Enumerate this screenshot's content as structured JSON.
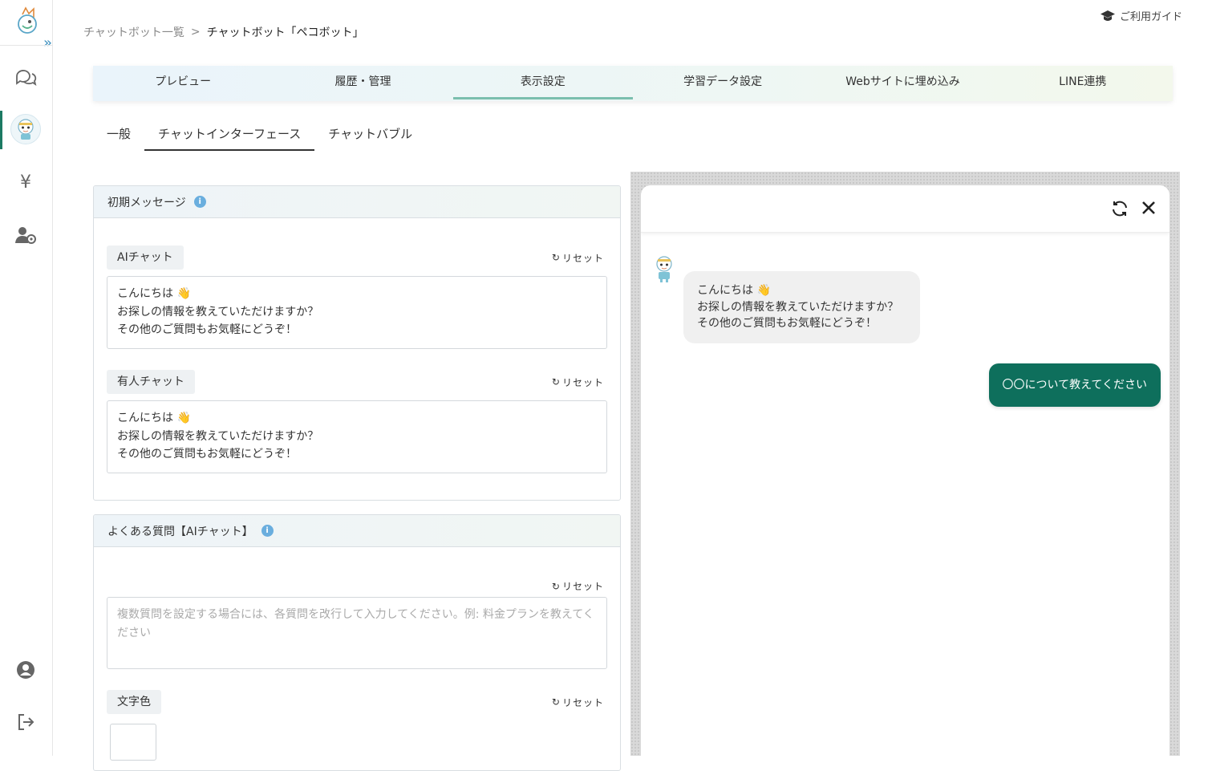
{
  "sidebar": {
    "icons": [
      "logo-icon",
      "expand-icon",
      "chat-icon",
      "chatbot-avatar-icon",
      "yen-icon",
      "user-settings-icon",
      "account-icon",
      "logout-icon"
    ]
  },
  "breadcrumb": {
    "parent": "チャットボット一覧",
    "separator": ">",
    "current": "チャットボット「ペコボット」"
  },
  "guide": {
    "label": "ご利用ガイド"
  },
  "main_tabs": [
    {
      "label": "プレビュー"
    },
    {
      "label": "履歴・管理"
    },
    {
      "label": "表示設定",
      "active": true
    },
    {
      "label": "学習データ設定"
    },
    {
      "label": "Webサイトに埋め込み"
    },
    {
      "label": "LINE連携"
    }
  ],
  "sub_tabs": [
    {
      "label": "一般"
    },
    {
      "label": "チャットインターフェース",
      "active": true
    },
    {
      "label": "チャットバブル"
    }
  ],
  "initial_message": {
    "title": "初期メッセージ",
    "ai_chat": {
      "label": "AIチャット",
      "reset": "リセット",
      "lines": [
        "こんにちは 👋",
        "お探しの情報を教えていただけますか？",
        "その他のご質問もお気軽にどうぞ！"
      ]
    },
    "human_chat": {
      "label": "有人チャット",
      "reset": "リセット",
      "lines": [
        "こんにちは 👋",
        "お探しの情報を教えていただけますか？",
        "その他のご質問もお気軽にどうぞ！"
      ]
    }
  },
  "faq": {
    "title": "よくある質問【AIチャット】",
    "reset": "リセット",
    "placeholder": "複数質問を設定する場合には、各質問を改行して入力してください。例: 料金プランを教えてください",
    "text_color": {
      "label": "文字色",
      "reset": "リセット",
      "value": "#ffffff"
    }
  },
  "preview": {
    "bot_lines": [
      "こんにちは 👋",
      "お探しの情報を教えていただけますか？",
      "その他のご質問もお気軽にどうぞ！"
    ],
    "user_message": "〇〇について教えてください",
    "user_bubble_color": "#0e6f5c"
  },
  "colors": {
    "accent": "#1c7a63",
    "tab_underline": "#7bbfae",
    "info": "#6aaede"
  }
}
